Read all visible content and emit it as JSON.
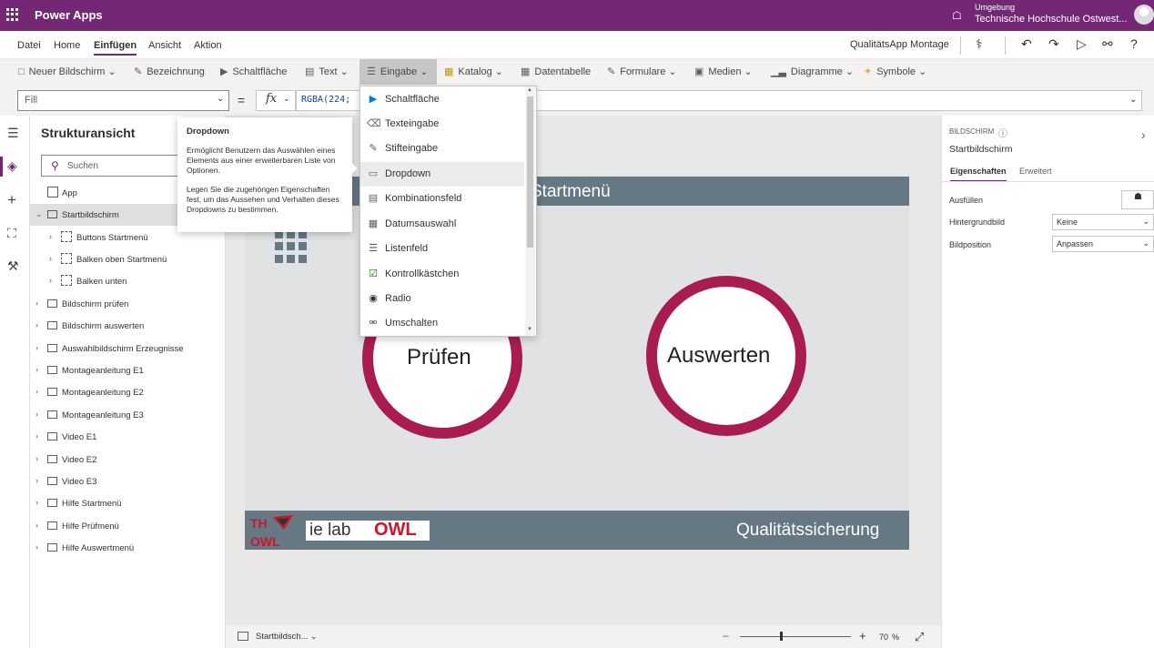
{
  "header": {
    "app_name": "Power Apps",
    "env_label": "Umgebung",
    "env_name": "Technische Hochschule Ostwest...",
    "brand_color": "#742774"
  },
  "menu": {
    "items": [
      "Datei",
      "Home",
      "Einfügen",
      "Ansicht",
      "Aktion"
    ],
    "active": "Einfügen",
    "app_title": "QualitätsApp Montage"
  },
  "ribbon": {
    "items": [
      {
        "label": "Neuer Bildschirm",
        "icon": "new-screen-icon"
      },
      {
        "label": "Bezeichnung",
        "icon": "label-icon"
      },
      {
        "label": "Schaltfläche",
        "icon": "button-icon"
      },
      {
        "label": "Text",
        "icon": "text-icon"
      },
      {
        "label": "Eingabe",
        "icon": "input-icon"
      },
      {
        "label": "Katalog",
        "icon": "gallery-icon"
      },
      {
        "label": "Datentabelle",
        "icon": "datatable-icon"
      },
      {
        "label": "Formulare",
        "icon": "form-icon"
      },
      {
        "label": "Medien",
        "icon": "media-icon"
      },
      {
        "label": "Diagramme",
        "icon": "chart-icon"
      },
      {
        "label": "Symbole",
        "icon": "icons-icon"
      }
    ]
  },
  "formula_bar": {
    "property": "Fill",
    "equals": "=",
    "fx": "fx",
    "formula": "RGBA(224;"
  },
  "tree": {
    "title": "Strukturansicht",
    "search_placeholder": "Suchen",
    "items": [
      {
        "label": "App",
        "type": "app"
      },
      {
        "label": "Startbildschirm",
        "type": "screen",
        "selected": true,
        "expanded": true
      },
      {
        "label": "Buttons Startmenü",
        "type": "group"
      },
      {
        "label": "Balken oben Startmenü",
        "type": "group"
      },
      {
        "label": "Balken unten",
        "type": "group"
      },
      {
        "label": "Bildschirm prüfen",
        "type": "screen"
      },
      {
        "label": "Bildschirm auswerten",
        "type": "screen"
      },
      {
        "label": "Auswahlbildschirm Erzeugnisse",
        "type": "screen"
      },
      {
        "label": "Montageanleitung E1",
        "type": "screen"
      },
      {
        "label": "Montageanleitung E2",
        "type": "screen"
      },
      {
        "label": "Montageanleitung E3",
        "type": "screen"
      },
      {
        "label": "Video E1",
        "type": "screen"
      },
      {
        "label": "Video E2",
        "type": "screen"
      },
      {
        "label": "Video E3",
        "type": "screen"
      },
      {
        "label": "Hilfe Startmenü",
        "type": "screen"
      },
      {
        "label": "Hilfe Prüfmenü",
        "type": "screen"
      },
      {
        "label": "Hilfe Auswertmenü",
        "type": "screen"
      }
    ]
  },
  "dropdown_menu": {
    "items": [
      {
        "label": "Schaltfläche",
        "icon": "button-icon"
      },
      {
        "label": "Texteingabe",
        "icon": "text-input-icon"
      },
      {
        "label": "Stifteingabe",
        "icon": "pen-input-icon"
      },
      {
        "label": "Dropdown",
        "icon": "dropdown-icon",
        "hover": true
      },
      {
        "label": "Kombinationsfeld",
        "icon": "combobox-icon"
      },
      {
        "label": "Datumsauswahl",
        "icon": "calendar-icon"
      },
      {
        "label": "Listenfeld",
        "icon": "listbox-icon"
      },
      {
        "label": "Kontrollkästchen",
        "icon": "checkbox-icon"
      },
      {
        "label": "Radio",
        "icon": "radio-icon"
      },
      {
        "label": "Umschalten",
        "icon": "toggle-icon"
      }
    ]
  },
  "tooltip": {
    "title": "Dropdown",
    "p1": "Ermöglicht Benutzern das Auswählen eines Elements aus einer erweiterbaren Liste von Optionen.",
    "p2": "Legen Sie die zugehörigen Eigenschaften fest, um das Aussehen und Verhalten dieses Dropdowns zu bestimmen."
  },
  "canvas": {
    "top_title": "Startmenü",
    "button1": "Prüfen",
    "button2": "Auswerten",
    "logo_left": "TH OWL",
    "logo_ielab": "ie lab",
    "logo_owl": "OWL",
    "footer_text": "Qualitätssicherung",
    "accent_color": "#a81c52",
    "band_color": "#657884"
  },
  "bottom_bar": {
    "screen_name": "Startbildsch...",
    "zoom": "70",
    "zoom_unit": "%"
  },
  "properties_panel": {
    "kind": "BILDSCHIRM",
    "name": "Startbildschirm",
    "tabs": [
      "Eigenschaften",
      "Erweitert"
    ],
    "rows": [
      {
        "label": "Ausfüllen",
        "value": ""
      },
      {
        "label": "Hintergrundbild",
        "value": "Keine"
      },
      {
        "label": "Bildposition",
        "value": "Anpassen"
      }
    ]
  }
}
